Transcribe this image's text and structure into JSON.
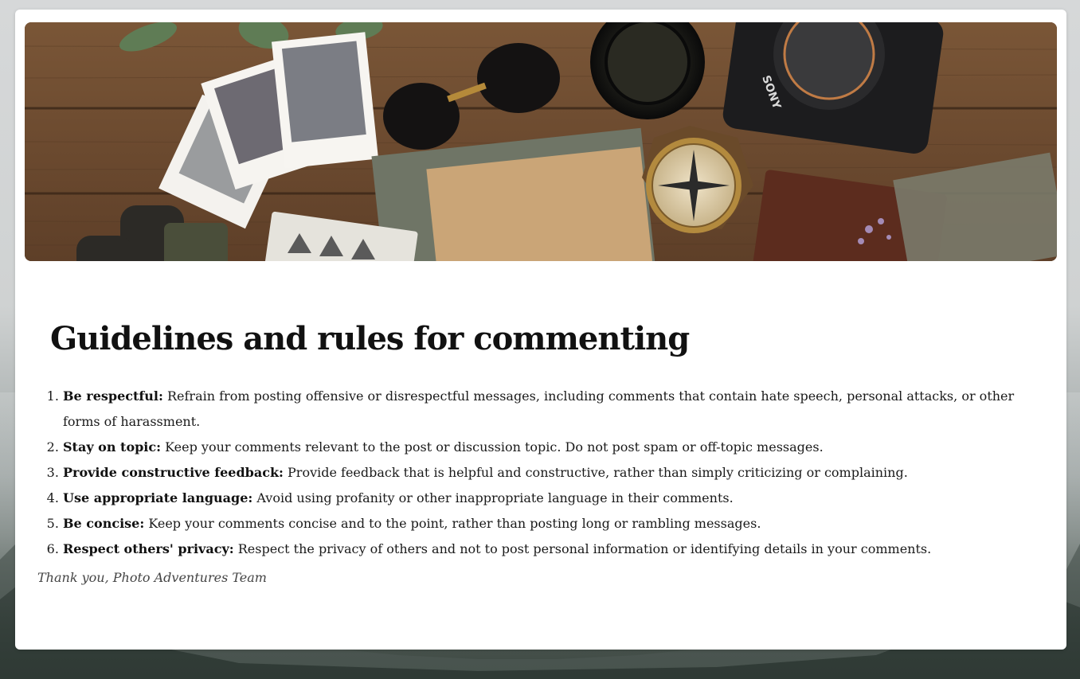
{
  "hero": {
    "image_icon": "travel-flatlay-photo",
    "camera_brand": "SONY"
  },
  "article": {
    "title": "Guidelines and rules for commenting",
    "rules": [
      {
        "heading": "Be respectful:",
        "text": "Refrain from posting offensive or disrespectful messages, including comments that contain hate speech, personal attacks, or other forms of harassment."
      },
      {
        "heading": "Stay on topic:",
        "text": "Keep your comments relevant to the post or discussion topic. Do not post spam or off-topic messages."
      },
      {
        "heading": "Provide constructive feedback:",
        "text": "Provide feedback that is helpful and constructive, rather than simply criticizing or complaining."
      },
      {
        "heading": "Use appropriate language:",
        "text": "Avoid using profanity or other inappropriate language in their comments."
      },
      {
        "heading": "Be concise:",
        "text": "Keep your comments concise and to the point, rather than posting long or rambling messages."
      },
      {
        "heading": "Respect others' privacy:",
        "text": "Respect the privacy of others and not to post personal information or identifying details in your comments."
      }
    ],
    "signoff": "Thank you, Photo Adventures Team"
  },
  "colors": {
    "card_background": "#ffffff",
    "title_text": "#111111",
    "body_text": "#1a1a1a",
    "signoff_text": "#444444"
  }
}
